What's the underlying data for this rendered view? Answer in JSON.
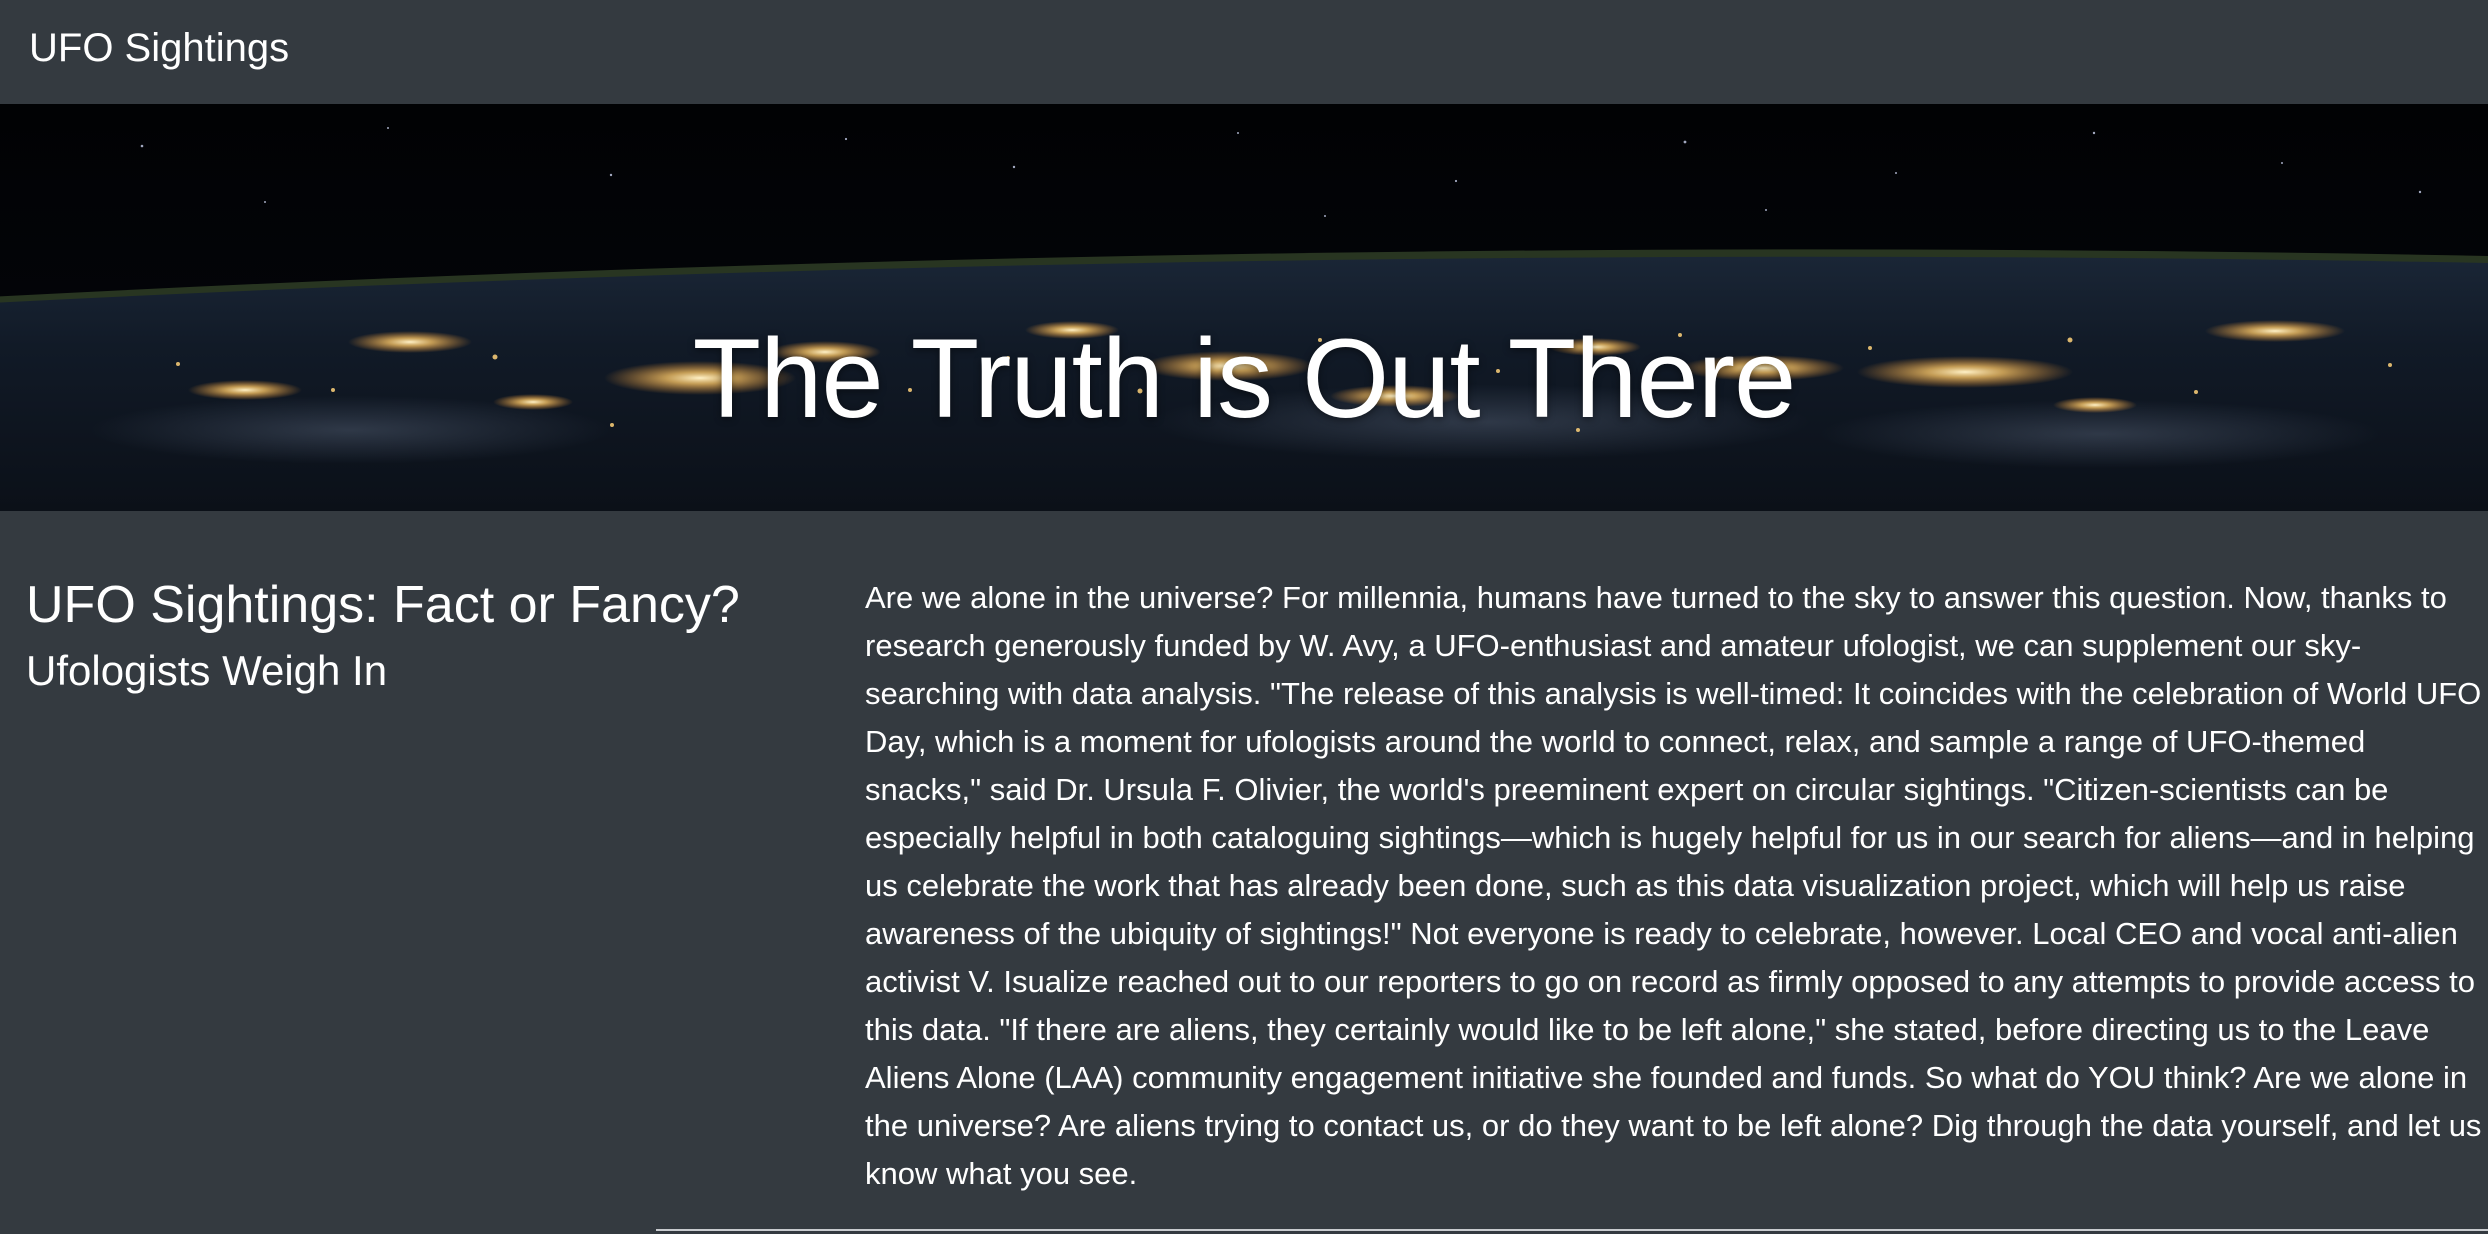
{
  "navbar": {
    "brand": "UFO Sightings"
  },
  "hero": {
    "title": "The Truth is Out There"
  },
  "article": {
    "title": "UFO Sightings: Fact or Fancy?",
    "subtitle": "Ufologists Weigh In",
    "body": "Are we alone in the universe? For millennia, humans have turned to the sky to answer this question. Now, thanks to research generously funded by W. Avy, a UFO-enthusiast and amateur ufologist, we can supplement our sky-searching with data analysis. \"The release of this analysis is well-timed: It coincides with the celebration of World UFO Day, which is a moment for ufologists around the world to connect, relax, and sample a range of UFO-themed snacks,\" said Dr. Ursula F. Olivier, the world's preeminent expert on circular sightings. \"Citizen-scientists can be especially helpful in both cataloguing sightings—which is hugely helpful for us in our search for aliens—and in helping us celebrate the work that has already been done, such as this data visualization project, which will help us raise awareness of the ubiquity of sightings!\" Not everyone is ready to celebrate, however. Local CEO and vocal anti-alien activist V. Isualize reached out to our reporters to go on record as firmly opposed to any attempts to provide access to this data. \"If there are aliens, they certainly would like to be left alone,\" she stated, before directing us to the Leave Aliens Alone (LAA) community engagement initiative she founded and funds. So what do YOU think? Are we alone in the universe? Are aliens trying to contact us, or do they want to be left alone? Dig through the data yourself, and let us know what you see."
  },
  "colors": {
    "background": "#343a40",
    "text": "#ffffff",
    "city_lights": "#ffd27a"
  }
}
